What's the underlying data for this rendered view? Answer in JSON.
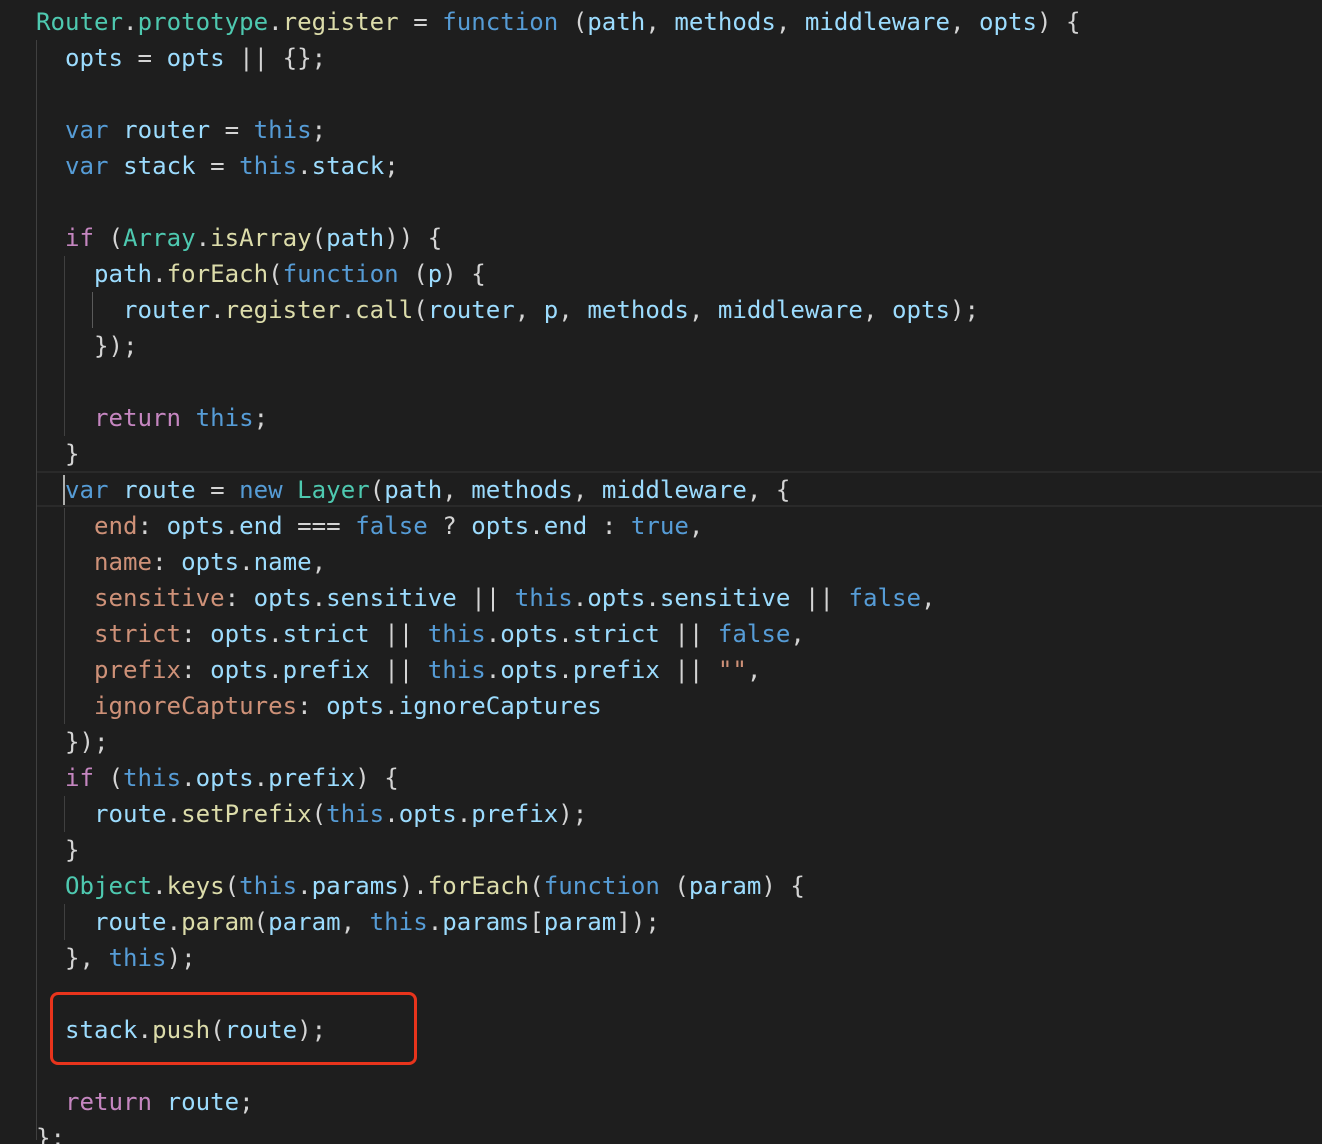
{
  "editor": {
    "lines": [
      [
        [
          "type",
          "Router"
        ],
        [
          "pl",
          "."
        ],
        [
          "type",
          "prototype"
        ],
        [
          "pl",
          "."
        ],
        [
          "fn",
          "register"
        ],
        [
          "pl",
          " = "
        ],
        [
          "kw",
          "function"
        ],
        [
          "pl",
          " ("
        ],
        [
          "var",
          "path"
        ],
        [
          "pl",
          ", "
        ],
        [
          "var",
          "methods"
        ],
        [
          "pl",
          ", "
        ],
        [
          "var",
          "middleware"
        ],
        [
          "pl",
          ", "
        ],
        [
          "var",
          "opts"
        ],
        [
          "pl",
          ") {"
        ]
      ],
      [
        [
          "pl",
          "  "
        ],
        [
          "var",
          "opts"
        ],
        [
          "pl",
          " = "
        ],
        [
          "var",
          "opts"
        ],
        [
          "pl",
          " || {};"
        ]
      ],
      [],
      [
        [
          "pl",
          "  "
        ],
        [
          "kw",
          "var"
        ],
        [
          "pl",
          " "
        ],
        [
          "var",
          "router"
        ],
        [
          "pl",
          " = "
        ],
        [
          "kw",
          "this"
        ],
        [
          "pl",
          ";"
        ]
      ],
      [
        [
          "pl",
          "  "
        ],
        [
          "kw",
          "var"
        ],
        [
          "pl",
          " "
        ],
        [
          "var",
          "stack"
        ],
        [
          "pl",
          " = "
        ],
        [
          "kw",
          "this"
        ],
        [
          "pl",
          "."
        ],
        [
          "var",
          "stack"
        ],
        [
          "pl",
          ";"
        ]
      ],
      [],
      [
        [
          "pl",
          "  "
        ],
        [
          "ctl",
          "if"
        ],
        [
          "pl",
          " ("
        ],
        [
          "type",
          "Array"
        ],
        [
          "pl",
          "."
        ],
        [
          "fn",
          "isArray"
        ],
        [
          "pl",
          "("
        ],
        [
          "var",
          "path"
        ],
        [
          "pl",
          ")) {"
        ]
      ],
      [
        [
          "pl",
          "    "
        ],
        [
          "var",
          "path"
        ],
        [
          "pl",
          "."
        ],
        [
          "fn",
          "forEach"
        ],
        [
          "pl",
          "("
        ],
        [
          "kw",
          "function"
        ],
        [
          "pl",
          " ("
        ],
        [
          "var",
          "p"
        ],
        [
          "pl",
          ") {"
        ]
      ],
      [
        [
          "pl",
          "      "
        ],
        [
          "var",
          "router"
        ],
        [
          "pl",
          "."
        ],
        [
          "fn",
          "register"
        ],
        [
          "pl",
          "."
        ],
        [
          "fn",
          "call"
        ],
        [
          "pl",
          "("
        ],
        [
          "var",
          "router"
        ],
        [
          "pl",
          ", "
        ],
        [
          "var",
          "p"
        ],
        [
          "pl",
          ", "
        ],
        [
          "var",
          "methods"
        ],
        [
          "pl",
          ", "
        ],
        [
          "var",
          "middleware"
        ],
        [
          "pl",
          ", "
        ],
        [
          "var",
          "opts"
        ],
        [
          "pl",
          ");"
        ]
      ],
      [
        [
          "pl",
          "    });"
        ]
      ],
      [],
      [
        [
          "pl",
          "    "
        ],
        [
          "ctl",
          "return"
        ],
        [
          "pl",
          " "
        ],
        [
          "kw",
          "this"
        ],
        [
          "pl",
          ";"
        ]
      ],
      [
        [
          "pl",
          "  }"
        ]
      ],
      [
        [
          "pl",
          "  "
        ],
        [
          "kw",
          "var"
        ],
        [
          "pl",
          " "
        ],
        [
          "var",
          "route"
        ],
        [
          "pl",
          " = "
        ],
        [
          "kw",
          "new"
        ],
        [
          "pl",
          " "
        ],
        [
          "type",
          "Layer"
        ],
        [
          "pl",
          "("
        ],
        [
          "var",
          "path"
        ],
        [
          "pl",
          ", "
        ],
        [
          "var",
          "methods"
        ],
        [
          "pl",
          ", "
        ],
        [
          "var",
          "middleware"
        ],
        [
          "pl",
          ", {"
        ]
      ],
      [
        [
          "pl",
          "    "
        ],
        [
          "prop",
          "end"
        ],
        [
          "pl",
          ": "
        ],
        [
          "var",
          "opts"
        ],
        [
          "pl",
          "."
        ],
        [
          "var",
          "end"
        ],
        [
          "pl",
          " === "
        ],
        [
          "kw",
          "false"
        ],
        [
          "pl",
          " ? "
        ],
        [
          "var",
          "opts"
        ],
        [
          "pl",
          "."
        ],
        [
          "var",
          "end"
        ],
        [
          "pl",
          " : "
        ],
        [
          "kw",
          "true"
        ],
        [
          "pl",
          ","
        ]
      ],
      [
        [
          "pl",
          "    "
        ],
        [
          "prop",
          "name"
        ],
        [
          "pl",
          ": "
        ],
        [
          "var",
          "opts"
        ],
        [
          "pl",
          "."
        ],
        [
          "var",
          "name"
        ],
        [
          "pl",
          ","
        ]
      ],
      [
        [
          "pl",
          "    "
        ],
        [
          "prop",
          "sensitive"
        ],
        [
          "pl",
          ": "
        ],
        [
          "var",
          "opts"
        ],
        [
          "pl",
          "."
        ],
        [
          "var",
          "sensitive"
        ],
        [
          "pl",
          " || "
        ],
        [
          "kw",
          "this"
        ],
        [
          "pl",
          "."
        ],
        [
          "var",
          "opts"
        ],
        [
          "pl",
          "."
        ],
        [
          "var",
          "sensitive"
        ],
        [
          "pl",
          " || "
        ],
        [
          "kw",
          "false"
        ],
        [
          "pl",
          ","
        ]
      ],
      [
        [
          "pl",
          "    "
        ],
        [
          "prop",
          "strict"
        ],
        [
          "pl",
          ": "
        ],
        [
          "var",
          "opts"
        ],
        [
          "pl",
          "."
        ],
        [
          "var",
          "strict"
        ],
        [
          "pl",
          " || "
        ],
        [
          "kw",
          "this"
        ],
        [
          "pl",
          "."
        ],
        [
          "var",
          "opts"
        ],
        [
          "pl",
          "."
        ],
        [
          "var",
          "strict"
        ],
        [
          "pl",
          " || "
        ],
        [
          "kw",
          "false"
        ],
        [
          "pl",
          ","
        ]
      ],
      [
        [
          "pl",
          "    "
        ],
        [
          "prop",
          "prefix"
        ],
        [
          "pl",
          ": "
        ],
        [
          "var",
          "opts"
        ],
        [
          "pl",
          "."
        ],
        [
          "var",
          "prefix"
        ],
        [
          "pl",
          " || "
        ],
        [
          "kw",
          "this"
        ],
        [
          "pl",
          "."
        ],
        [
          "var",
          "opts"
        ],
        [
          "pl",
          "."
        ],
        [
          "var",
          "prefix"
        ],
        [
          "pl",
          " || "
        ],
        [
          "str",
          "\"\""
        ],
        [
          "pl",
          ","
        ]
      ],
      [
        [
          "pl",
          "    "
        ],
        [
          "prop",
          "ignoreCaptures"
        ],
        [
          "pl",
          ": "
        ],
        [
          "var",
          "opts"
        ],
        [
          "pl",
          "."
        ],
        [
          "var",
          "ignoreCaptures"
        ]
      ],
      [
        [
          "pl",
          "  });"
        ]
      ],
      [
        [
          "pl",
          "  "
        ],
        [
          "ctl",
          "if"
        ],
        [
          "pl",
          " ("
        ],
        [
          "kw",
          "this"
        ],
        [
          "pl",
          "."
        ],
        [
          "var",
          "opts"
        ],
        [
          "pl",
          "."
        ],
        [
          "var",
          "prefix"
        ],
        [
          "pl",
          ") {"
        ]
      ],
      [
        [
          "pl",
          "    "
        ],
        [
          "var",
          "route"
        ],
        [
          "pl",
          "."
        ],
        [
          "fn",
          "setPrefix"
        ],
        [
          "pl",
          "("
        ],
        [
          "kw",
          "this"
        ],
        [
          "pl",
          "."
        ],
        [
          "var",
          "opts"
        ],
        [
          "pl",
          "."
        ],
        [
          "var",
          "prefix"
        ],
        [
          "pl",
          ");"
        ]
      ],
      [
        [
          "pl",
          "  }"
        ]
      ],
      [
        [
          "pl",
          "  "
        ],
        [
          "type",
          "Object"
        ],
        [
          "pl",
          "."
        ],
        [
          "fn",
          "keys"
        ],
        [
          "pl",
          "("
        ],
        [
          "kw",
          "this"
        ],
        [
          "pl",
          "."
        ],
        [
          "var",
          "params"
        ],
        [
          "pl",
          ")."
        ],
        [
          "fn",
          "forEach"
        ],
        [
          "pl",
          "("
        ],
        [
          "kw",
          "function"
        ],
        [
          "pl",
          " ("
        ],
        [
          "var",
          "param"
        ],
        [
          "pl",
          ") {"
        ]
      ],
      [
        [
          "pl",
          "    "
        ],
        [
          "var",
          "route"
        ],
        [
          "pl",
          "."
        ],
        [
          "fn",
          "param"
        ],
        [
          "pl",
          "("
        ],
        [
          "var",
          "param"
        ],
        [
          "pl",
          ", "
        ],
        [
          "kw",
          "this"
        ],
        [
          "pl",
          "."
        ],
        [
          "var",
          "params"
        ],
        [
          "pl",
          "["
        ],
        [
          "var",
          "param"
        ],
        [
          "pl",
          "]);"
        ]
      ],
      [
        [
          "pl",
          "  }, "
        ],
        [
          "kw",
          "this"
        ],
        [
          "pl",
          ");"
        ]
      ],
      [],
      [
        [
          "pl",
          "  "
        ],
        [
          "var",
          "stack"
        ],
        [
          "pl",
          "."
        ],
        [
          "fn",
          "push"
        ],
        [
          "pl",
          "("
        ],
        [
          "var",
          "route"
        ],
        [
          "pl",
          ");"
        ]
      ],
      [],
      [
        [
          "pl",
          "  "
        ],
        [
          "ctl",
          "return"
        ],
        [
          "pl",
          " "
        ],
        [
          "var",
          "route"
        ],
        [
          "pl",
          ";"
        ]
      ],
      [
        [
          "pl",
          "};"
        ]
      ]
    ]
  }
}
